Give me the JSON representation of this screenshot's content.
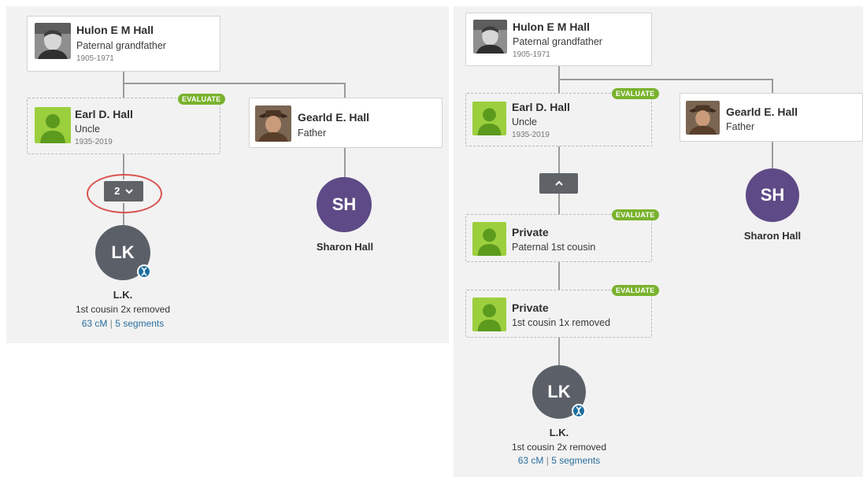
{
  "left": {
    "grandfather": {
      "name": "Hulon E M Hall",
      "relation": "Paternal grandfather",
      "years": "1905-1971"
    },
    "uncle": {
      "name": "Earl D. Hall",
      "relation": "Uncle",
      "years": "1935-2019",
      "badge": "EVALUATE"
    },
    "father": {
      "name": "Gearld E. Hall",
      "relation": "Father"
    },
    "expand_button": {
      "count": "2",
      "chevron": "chevron-down-icon"
    },
    "sharon": {
      "initials": "SH",
      "name": "Sharon Hall"
    },
    "match": {
      "initials": "LK",
      "name": "L.K.",
      "relation": "1st cousin 2x removed",
      "cm": "63 cM",
      "separator": "|",
      "segments": "5 segments",
      "badge_icon": "dna-icon"
    }
  },
  "right": {
    "grandfather": {
      "name": "Hulon E M Hall",
      "relation": "Paternal grandfather",
      "years": "1905-1971"
    },
    "uncle": {
      "name": "Earl D. Hall",
      "relation": "Uncle",
      "years": "1935-2019",
      "badge": "EVALUATE"
    },
    "father": {
      "name": "Gearld E. Hall",
      "relation": "Father"
    },
    "collapse_button": {
      "chevron": "chevron-up-icon"
    },
    "private1": {
      "name": "Private",
      "relation": "Paternal 1st cousin",
      "badge": "EVALUATE"
    },
    "private2": {
      "name": "Private",
      "relation": "1st cousin 1x removed",
      "badge": "EVALUATE"
    },
    "sharon": {
      "initials": "SH",
      "name": "Sharon Hall"
    },
    "match": {
      "initials": "LK",
      "name": "L.K.",
      "relation": "1st cousin 2x removed",
      "cm": "63 cM",
      "separator": "|",
      "segments": "5 segments",
      "badge_icon": "dna-icon"
    }
  },
  "colors": {
    "evaluate_green": "#79b22d",
    "match_gray": "#5b6068",
    "sharon_purple": "#5e4a86",
    "link_blue": "#2a6f9e",
    "highlight_red": "#d9534f"
  }
}
